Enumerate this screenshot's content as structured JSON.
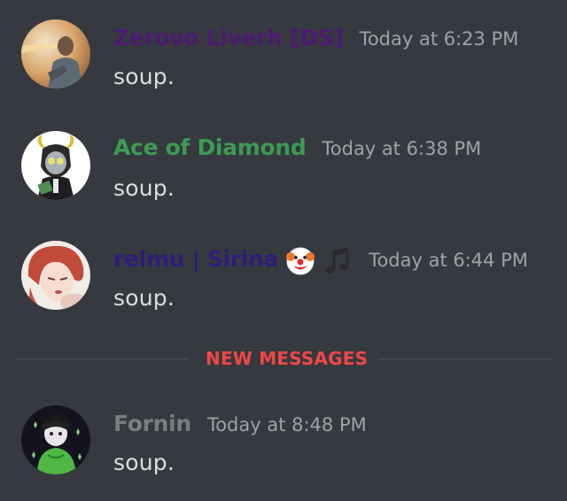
{
  "messages": [
    {
      "username": "Zerovo Liverh [DS]",
      "username_color": "#4d1a73",
      "timestamp": "Today at 6:23 PM",
      "content": "soup."
    },
    {
      "username": "Ace of Diamond",
      "username_color": "#3d9a54",
      "timestamp": "Today at 6:38 PM",
      "content": "soup."
    },
    {
      "username": "relmu | Sirina",
      "username_color": "#2e1d7a",
      "timestamp": "Today at 6:44 PM",
      "content": "soup.",
      "emojis": [
        "clown-face",
        "musical-note"
      ]
    },
    {
      "username": "Fornin",
      "username_color": "#7a7d82",
      "timestamp": "Today at 8:48 PM",
      "content": "soup."
    }
  ],
  "divider": {
    "label": "NEW MESSAGES",
    "color": "#f04747"
  }
}
